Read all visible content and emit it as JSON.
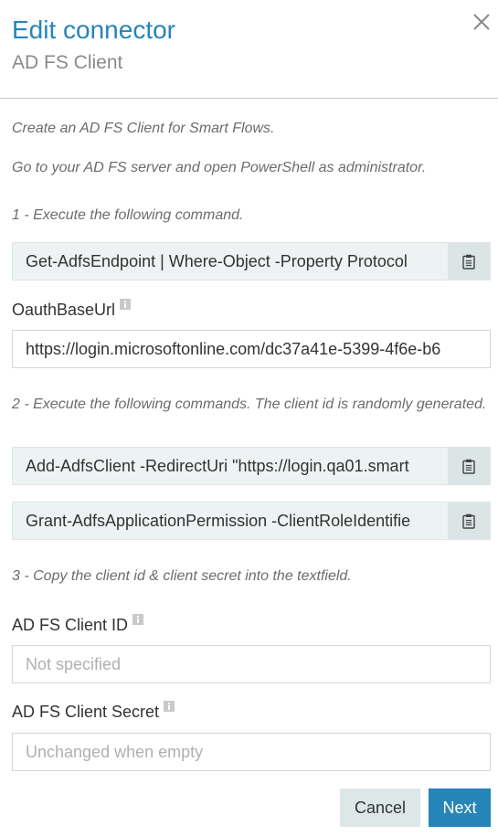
{
  "dialog": {
    "title": "Edit connector",
    "subtitle": "AD FS Client",
    "close_icon": "close-icon"
  },
  "instructions": {
    "intro": "Create an AD FS Client for Smart Flows.",
    "step0": "Go to your AD FS server and open PowerShell as administrator.",
    "step1": "1 - Execute the following command.",
    "step2": "2 - Execute the following commands. The client id is randomly generated.",
    "step3": "3 - Copy the client id & client secret into the textfield."
  },
  "commands": {
    "cmd1": "Get-AdfsEndpoint | Where-Object -Property Protocol",
    "cmd2": "Add-AdfsClient -RedirectUri \"https://login.qa01.smart",
    "cmd3": "Grant-AdfsApplicationPermission -ClientRoleIdentifie",
    "copy_icon": "clipboard-icon"
  },
  "fields": {
    "oauth_base_url": {
      "label": "OauthBaseUrl",
      "value": "https://login.microsoftonline.com/dc37a41e-5399-4f6e-b6",
      "info_icon": "info-icon"
    },
    "client_id": {
      "label": "AD FS Client ID",
      "placeholder": "Not specified",
      "info_icon": "info-icon"
    },
    "client_secret": {
      "label": "AD FS Client Secret",
      "placeholder": "Unchanged when empty",
      "info_icon": "info-icon"
    }
  },
  "actions": {
    "cancel_label": "Cancel",
    "next_label": "Next"
  },
  "colors": {
    "accent": "#2585b9",
    "command_bg": "#edf2f2",
    "copy_button_bg": "#dbe5e5",
    "cancel_bg": "#dde7e7"
  }
}
